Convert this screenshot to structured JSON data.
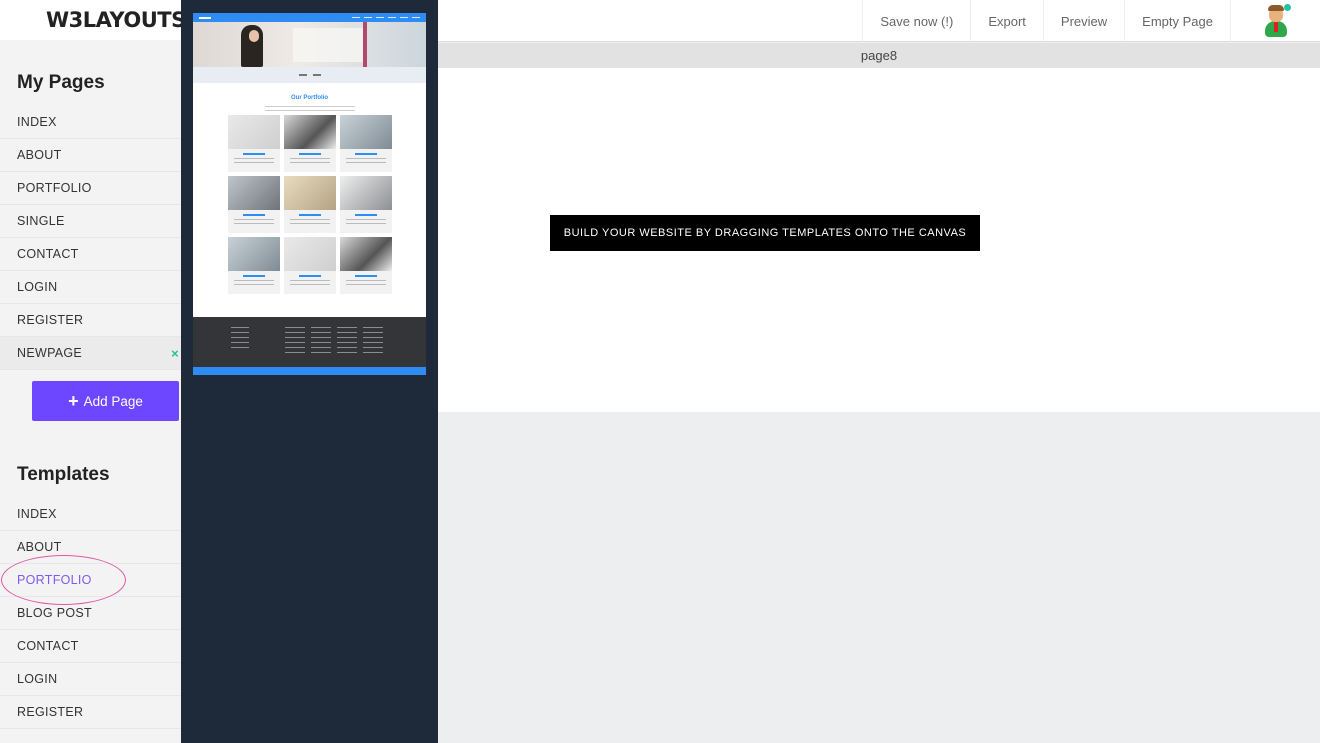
{
  "brand": {
    "logo_text": "W3LAYOUTS"
  },
  "sidebar": {
    "pages_title": "My Pages",
    "pages": [
      {
        "label": "INDEX"
      },
      {
        "label": "ABOUT"
      },
      {
        "label": "PORTFOLIO"
      },
      {
        "label": "SINGLE"
      },
      {
        "label": "CONTACT"
      },
      {
        "label": "LOGIN"
      },
      {
        "label": "REGISTER"
      },
      {
        "label": "NEWPAGE",
        "remove_icon": "×"
      }
    ],
    "add_page_plus": "+",
    "add_page_label": "Add Page",
    "templates_title": "Templates",
    "templates": [
      {
        "label": "INDEX"
      },
      {
        "label": "ABOUT"
      },
      {
        "label": "PORTFOLIO",
        "selected": true
      },
      {
        "label": "BLOG POST"
      },
      {
        "label": "CONTACT"
      },
      {
        "label": "LOGIN"
      },
      {
        "label": "REGISTER"
      }
    ]
  },
  "preview_panel": {
    "thumbnail_title": "Our Portfolio"
  },
  "topbar": {
    "actions": [
      "Save now (!)",
      "Export",
      "Preview",
      "Empty Page"
    ],
    "avatar_icon": "user-avatar-icon"
  },
  "page_bar": {
    "name": "page8"
  },
  "canvas": {
    "hint": "BUILD YOUR WEBSITE BY DRAGGING TEMPLATES ONTO THE CANVAS"
  },
  "colors": {
    "accent": "#6c47ff",
    "selected_text": "#7b5cf0",
    "remove_icon": "#21c29a",
    "panel_bg": "#1e2a3a",
    "thumbnail_accent": "#2f8cf2"
  }
}
